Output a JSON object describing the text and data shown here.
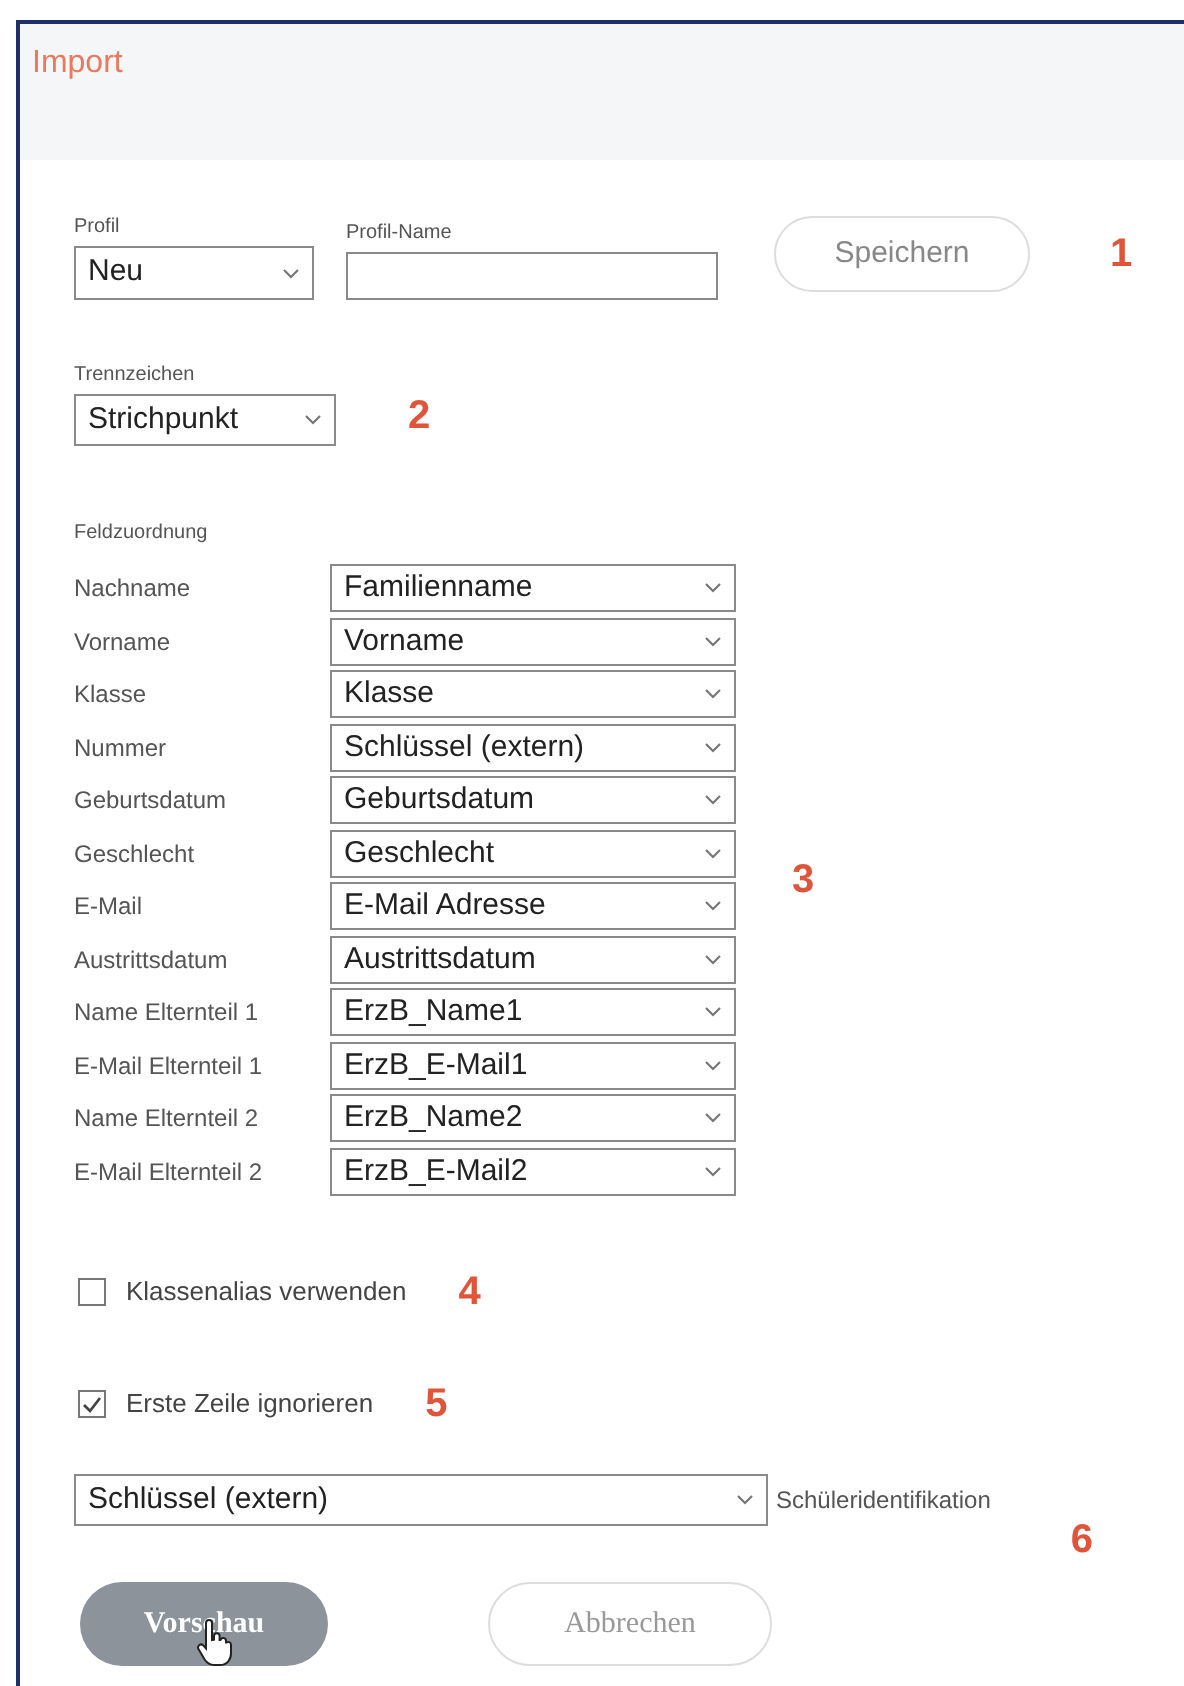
{
  "window": {
    "title": "Import"
  },
  "profile": {
    "label": "Profil",
    "value": "Neu",
    "name_label": "Profil-Name",
    "save_button": "Speichern",
    "marker": "1"
  },
  "separator": {
    "label": "Trennzeichen",
    "value": "Strichpunkt",
    "marker": "2"
  },
  "field_mapping": {
    "label": "Feldzuordnung",
    "marker": "3",
    "rows": [
      {
        "label": "Nachname",
        "value": "Familienname"
      },
      {
        "label": "Vorname",
        "value": "Vorname"
      },
      {
        "label": "Klasse",
        "value": "Klasse"
      },
      {
        "label": "Nummer",
        "value": "Schlüssel (extern)"
      },
      {
        "label": "Geburtsdatum",
        "value": "Geburtsdatum"
      },
      {
        "label": "Geschlecht",
        "value": "Geschlecht"
      },
      {
        "label": "E-Mail",
        "value": "E-Mail Adresse"
      },
      {
        "label": "Austrittsdatum",
        "value": "Austrittsdatum"
      },
      {
        "label": "Name Elternteil 1",
        "value": "ErzB_Name1"
      },
      {
        "label": "E-Mail Elternteil 1",
        "value": "ErzB_E-Mail1"
      },
      {
        "label": "Name Elternteil 2",
        "value": "ErzB_Name2"
      },
      {
        "label": "E-Mail Elternteil 2",
        "value": "ErzB_E-Mail2"
      }
    ]
  },
  "options": [
    {
      "label": "Klassenalias verwenden",
      "checked": false,
      "marker": "4"
    },
    {
      "label": "Erste Zeile ignorieren",
      "checked": true,
      "marker": "5"
    }
  ],
  "identification": {
    "value": "Schlüssel (extern)",
    "label": "Schüleridentifikation",
    "marker": "6"
  },
  "buttons": [
    {
      "label": "Vorschau",
      "kind": "primary"
    },
    {
      "label": "Abbrechen",
      "kind": "secondary"
    }
  ]
}
